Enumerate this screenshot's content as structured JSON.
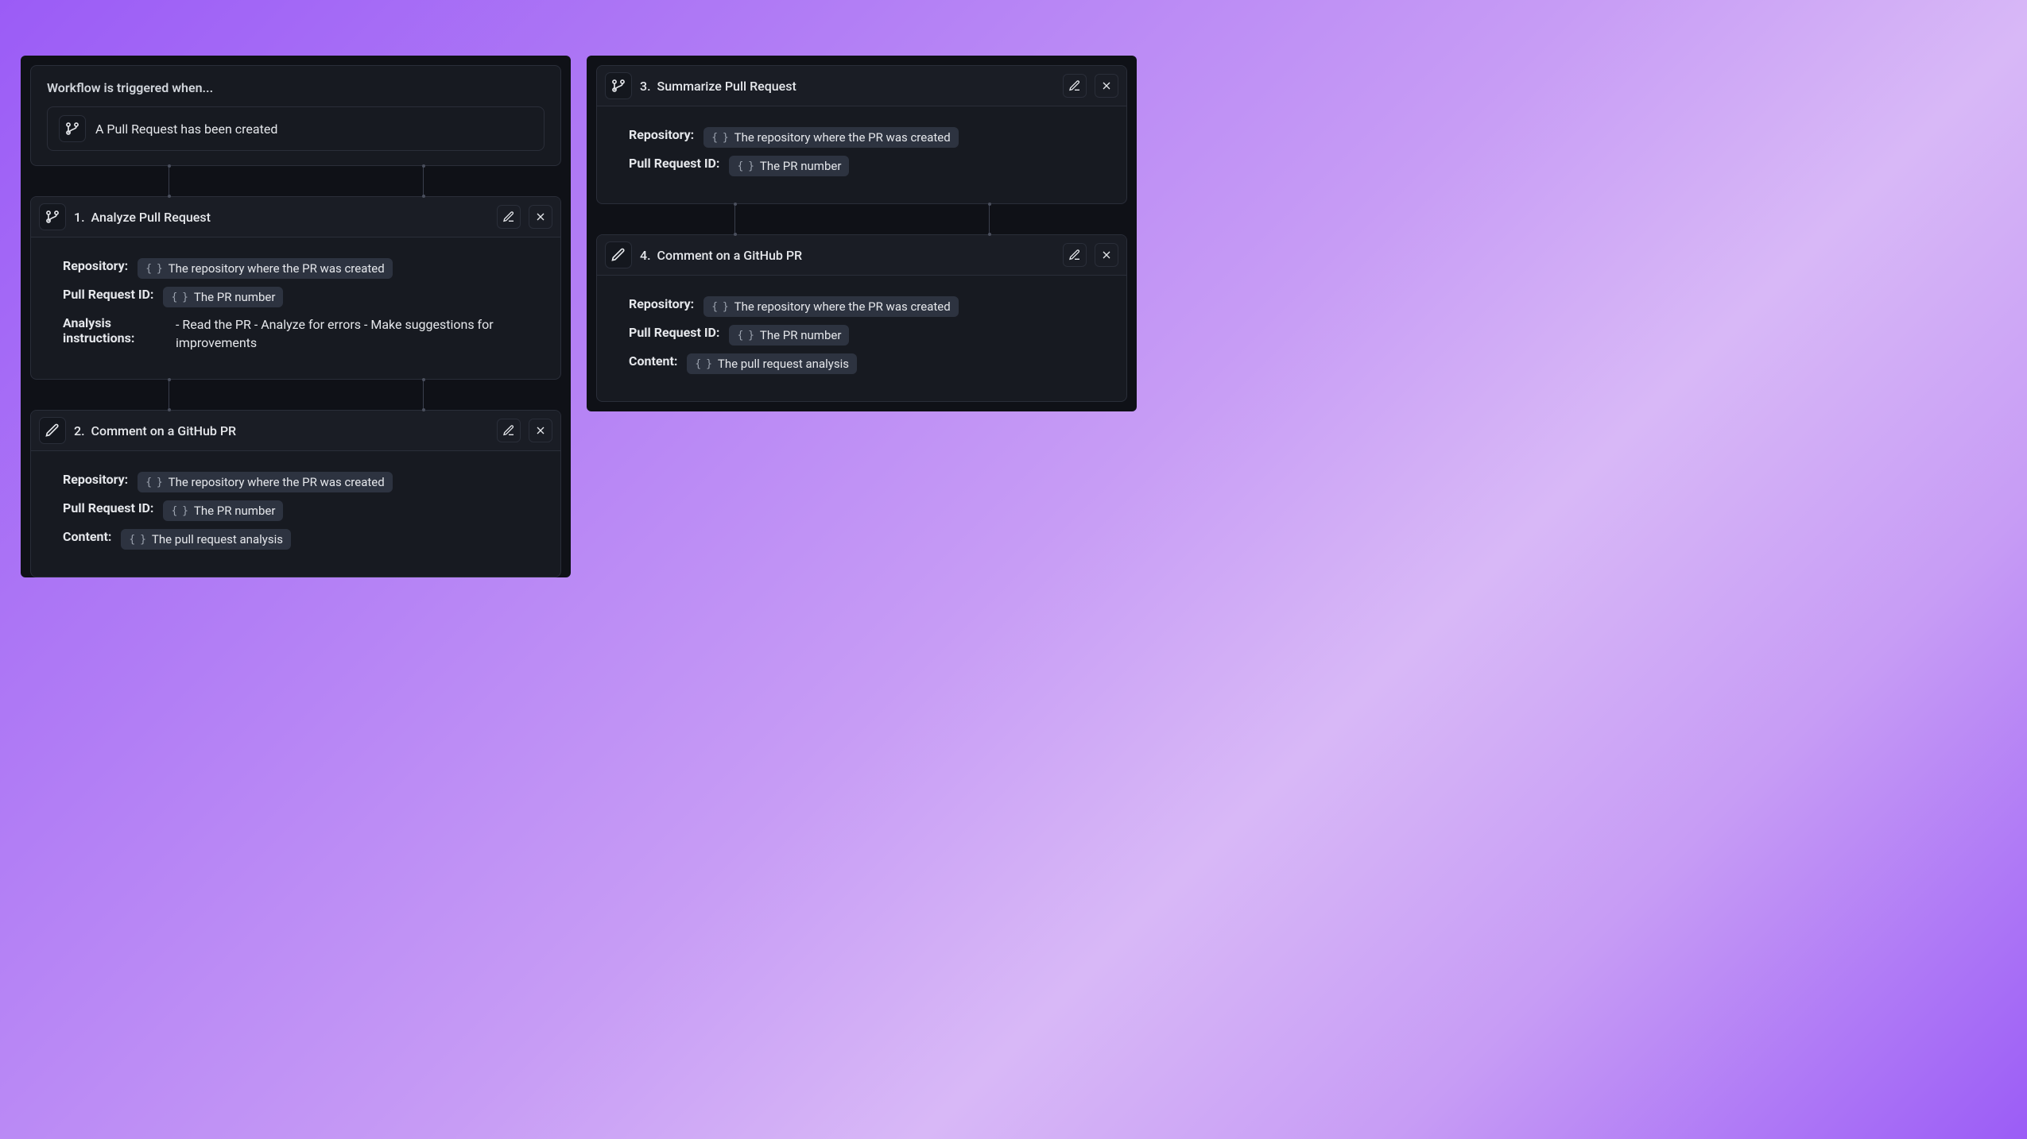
{
  "trigger": {
    "heading": "Workflow is triggered when...",
    "event": "A Pull Request has been created"
  },
  "steps": [
    {
      "icon": "git-branch",
      "number": "1.",
      "title": "Analyze Pull Request",
      "params": [
        {
          "label": "Repository:",
          "kind": "chip",
          "value": "The repository where the PR was created"
        },
        {
          "label": "Pull Request ID:",
          "kind": "chip",
          "value": "The PR number"
        },
        {
          "label": "Analysis instructions:",
          "kind": "text",
          "value": "- Read the PR - Analyze for errors - Make suggestions for improvements",
          "labelWide": true
        }
      ]
    },
    {
      "icon": "pencil",
      "number": "2.",
      "title": "Comment on a GitHub PR",
      "params": [
        {
          "label": "Repository:",
          "kind": "chip",
          "value": "The repository where the PR was created"
        },
        {
          "label": "Pull Request ID:",
          "kind": "chip",
          "value": "The PR number"
        },
        {
          "label": "Content:",
          "kind": "chip",
          "value": "The pull request analysis"
        }
      ]
    },
    {
      "icon": "git-branch",
      "number": "3.",
      "title": "Summarize Pull Request",
      "params": [
        {
          "label": "Repository:",
          "kind": "chip",
          "value": "The repository where the PR was created"
        },
        {
          "label": "Pull Request ID:",
          "kind": "chip",
          "value": "The PR number"
        }
      ]
    },
    {
      "icon": "pencil",
      "number": "4.",
      "title": "Comment on a GitHub PR",
      "params": [
        {
          "label": "Repository:",
          "kind": "chip",
          "value": "The repository where the PR was created"
        },
        {
          "label": "Pull Request ID:",
          "kind": "chip",
          "value": "The PR number"
        },
        {
          "label": "Content:",
          "kind": "chip",
          "value": "The pull request analysis"
        }
      ]
    }
  ]
}
